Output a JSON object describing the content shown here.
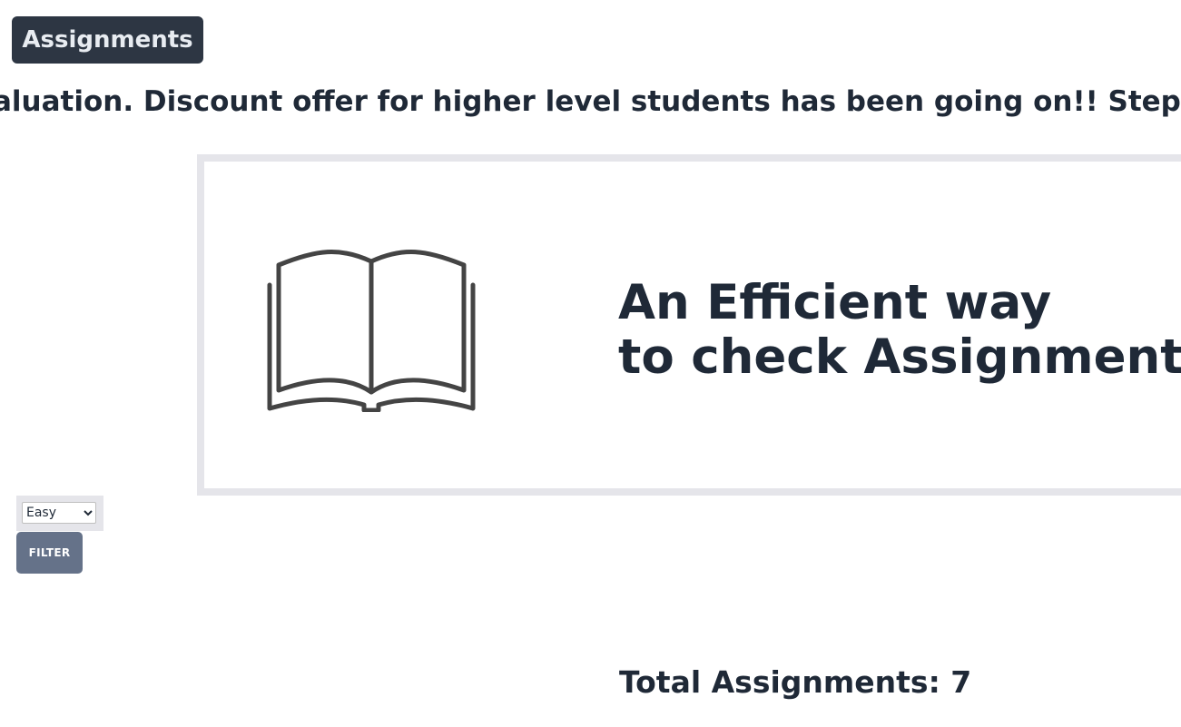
{
  "header": {
    "title": "Assignments"
  },
  "marquee": {
    "text": "aluation. Discount offer for higher level students has been going on!! Step rig"
  },
  "hero": {
    "icon": "open-book-icon",
    "heading_line1": "An Efficient way",
    "heading_line2": "to check Assignment"
  },
  "filter": {
    "selected": "Easy",
    "options": [
      "Easy"
    ],
    "button_label": "FILTER"
  },
  "summary": {
    "total_label": "Total Assignments: 7"
  },
  "colors": {
    "badge_bg": "#2d3643",
    "text_dark": "#1f2937",
    "hero_border": "#e5e5ea",
    "button_bg": "#657289",
    "icon_stroke": "#444444"
  }
}
